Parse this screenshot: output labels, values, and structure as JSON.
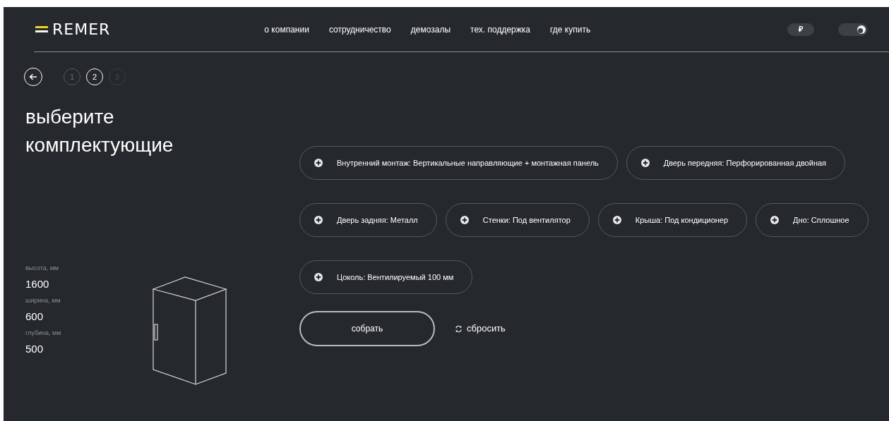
{
  "header": {
    "logo": "REMER",
    "nav": [
      "о компании",
      "сотрудничество",
      "демозалы",
      "тех. поддержка",
      "где купить"
    ],
    "currency": "₽",
    "theme_switch": {
      "on": true
    }
  },
  "steps": [
    {
      "label": "1",
      "selected": false,
      "done": true
    },
    {
      "label": "2",
      "selected": true,
      "done": false
    },
    {
      "label": "3",
      "selected": false,
      "done": false
    }
  ],
  "title": "выберите комплектующие",
  "specs": [
    {
      "label": "высота, мм",
      "value": "1600"
    },
    {
      "label": "ширина, мм",
      "value": "600"
    },
    {
      "label": "глубина, мм",
      "value": "500"
    }
  ],
  "options": [
    [
      "Внутренний монтаж: Вертикальные направляющие + монтажная панель",
      "Дверь передняя: Перфорированная двойная"
    ],
    [
      "Дверь задняя: Металл",
      "Стенки: Под вентилятор",
      "Крыша: Под кондиционер",
      "Дно: Сплошное"
    ],
    [
      "Цоколь: Вентилируемый 100 мм"
    ]
  ],
  "build_button": "собрать",
  "reset_link": "сбросить"
}
